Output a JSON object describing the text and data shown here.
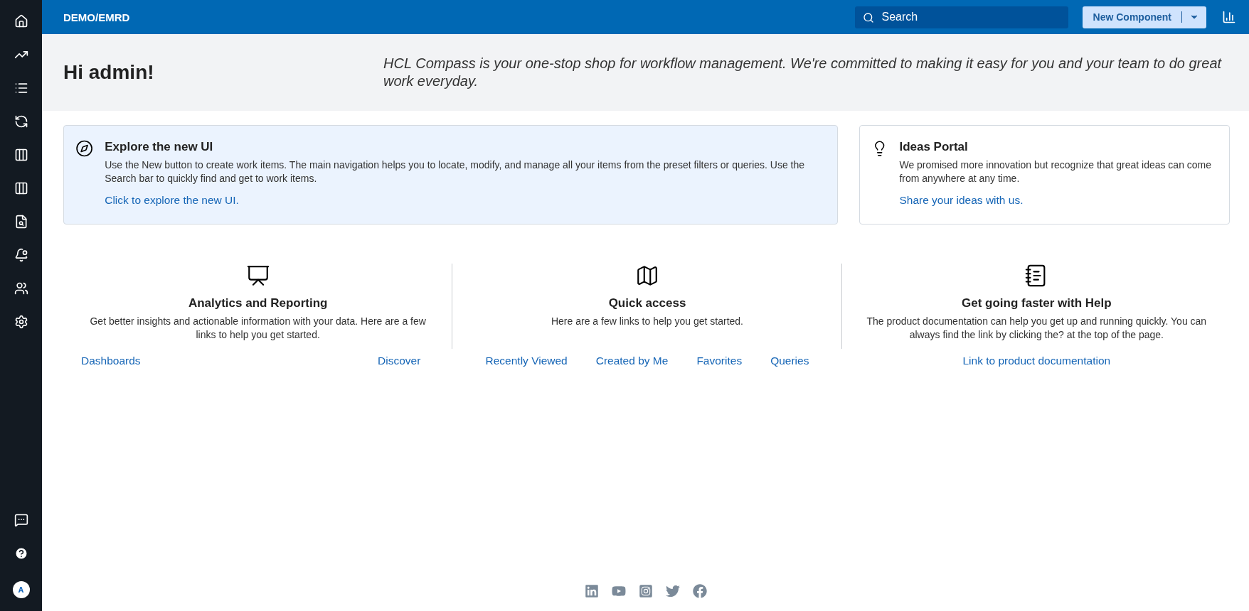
{
  "sidebar": {
    "avatar": "A"
  },
  "header": {
    "title": "DEMO/EMRD",
    "search": {
      "placeholder": "Search"
    },
    "new_button": "New Component"
  },
  "greeting": {
    "title": "Hi admin!",
    "tagline": "HCL Compass is your one-stop shop for workflow management. We're committed to making it easy for you and your team to do great work everyday."
  },
  "cards": [
    {
      "kind": "explore",
      "title": "Explore the new UI",
      "text": "Use the New button to create work items. The main navigation helps you to locate, modify, and manage all your items from the preset filters or queries. Use the Search bar to quickly find and get to work items.",
      "link": "Click to explore the new UI."
    },
    {
      "kind": "ideas",
      "title": "Ideas Portal",
      "text": "We promised more innovation but recognize that great ideas can come from anywhere at any time.",
      "link": "Share your ideas with us."
    }
  ],
  "sections": [
    {
      "kind": "analytics",
      "title": "Analytics and Reporting",
      "text": "Get better insights and actionable information with your data. Here are a few links to help you get started.",
      "links": [
        "Dashboards",
        "Discover"
      ]
    },
    {
      "kind": "quick",
      "title": "Quick access",
      "text": "Here are a few links to help you get started.",
      "links": [
        "Recently Viewed",
        "Created by Me",
        "Favorites",
        "Queries"
      ]
    },
    {
      "kind": "help",
      "title": "Get going faster with Help",
      "text": "The product documentation can help you get up and running quickly. You can always find the link by clicking the? at the top of the page.",
      "links": [
        "Link to product documentation"
      ]
    }
  ]
}
